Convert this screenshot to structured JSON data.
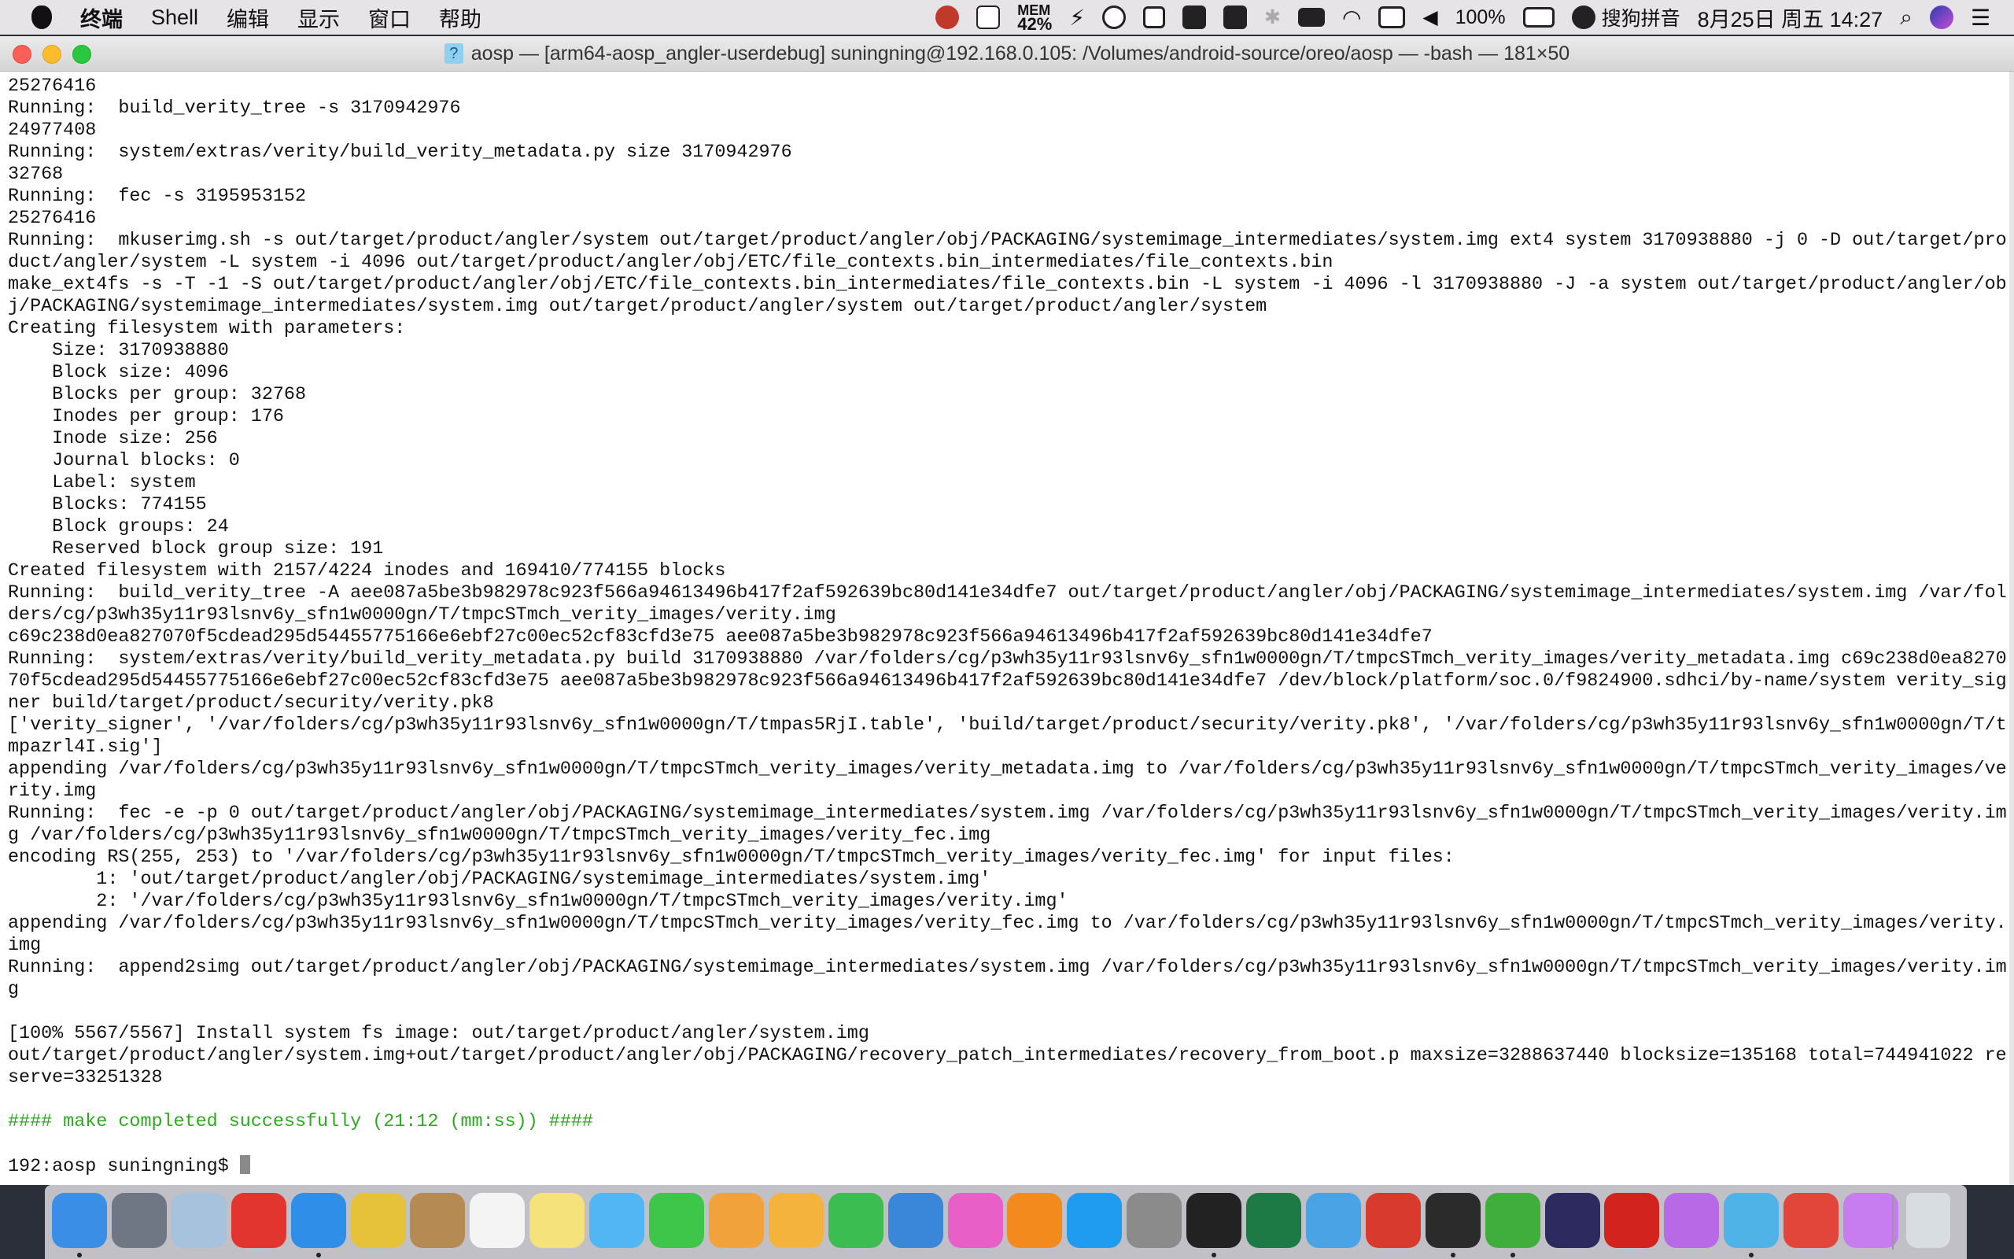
{
  "menubar": {
    "app_menus": [
      "终端",
      "Shell",
      "编辑",
      "显示",
      "窗口",
      "帮助"
    ],
    "mem_label": "MEM",
    "mem_value": "42%",
    "battery": "100%",
    "input_method": "搜狗拼音",
    "datetime": "8月25日 周五 14:27"
  },
  "window": {
    "title": "aosp — [arm64-aosp_angler-userdebug] suningning@192.168.0.105: /Volumes/android-source/oreo/aosp — -bash — 181×50",
    "title_icon": "?"
  },
  "terminal": {
    "success_color": "#2ea821",
    "lines": [
      "25276416",
      "Running:  build_verity_tree -s 3170942976",
      "24977408",
      "Running:  system/extras/verity/build_verity_metadata.py size 3170942976",
      "32768",
      "Running:  fec -s 3195953152",
      "25276416",
      "Running:  mkuserimg.sh -s out/target/product/angler/system out/target/product/angler/obj/PACKAGING/systemimage_intermediates/system.img ext4 system 3170938880 -j 0 -D out/target/pro",
      "duct/angler/system -L system -i 4096 out/target/product/angler/obj/ETC/file_contexts.bin_intermediates/file_contexts.bin",
      "make_ext4fs -s -T -1 -S out/target/product/angler/obj/ETC/file_contexts.bin_intermediates/file_contexts.bin -L system -i 4096 -l 3170938880 -J -a system out/target/product/angler/ob",
      "j/PACKAGING/systemimage_intermediates/system.img out/target/product/angler/system out/target/product/angler/system",
      "Creating filesystem with parameters:",
      "    Size: 3170938880",
      "    Block size: 4096",
      "    Blocks per group: 32768",
      "    Inodes per group: 176",
      "    Inode size: 256",
      "    Journal blocks: 0",
      "    Label: system",
      "    Blocks: 774155",
      "    Block groups: 24",
      "    Reserved block group size: 191",
      "Created filesystem with 2157/4224 inodes and 169410/774155 blocks",
      "Running:  build_verity_tree -A aee087a5be3b982978c923f566a94613496b417f2af592639bc80d141e34dfe7 out/target/product/angler/obj/PACKAGING/systemimage_intermediates/system.img /var/fol",
      "ders/cg/p3wh35y11r93lsnv6y_sfn1w0000gn/T/tmpcSTmch_verity_images/verity.img",
      "c69c238d0ea827070f5cdead295d54455775166e6ebf27c00ec52cf83cfd3e75 aee087a5be3b982978c923f566a94613496b417f2af592639bc80d141e34dfe7",
      "Running:  system/extras/verity/build_verity_metadata.py build 3170938880 /var/folders/cg/p3wh35y11r93lsnv6y_sfn1w0000gn/T/tmpcSTmch_verity_images/verity_metadata.img c69c238d0ea8270",
      "70f5cdead295d54455775166e6ebf27c00ec52cf83cfd3e75 aee087a5be3b982978c923f566a94613496b417f2af592639bc80d141e34dfe7 /dev/block/platform/soc.0/f9824900.sdhci/by-name/system verity_sig",
      "ner build/target/product/security/verity.pk8",
      "['verity_signer', '/var/folders/cg/p3wh35y11r93lsnv6y_sfn1w0000gn/T/tmpas5RjI.table', 'build/target/product/security/verity.pk8', '/var/folders/cg/p3wh35y11r93lsnv6y_sfn1w0000gn/T/t",
      "mpazrl4I.sig']",
      "appending /var/folders/cg/p3wh35y11r93lsnv6y_sfn1w0000gn/T/tmpcSTmch_verity_images/verity_metadata.img to /var/folders/cg/p3wh35y11r93lsnv6y_sfn1w0000gn/T/tmpcSTmch_verity_images/ve",
      "rity.img",
      "Running:  fec -e -p 0 out/target/product/angler/obj/PACKAGING/systemimage_intermediates/system.img /var/folders/cg/p3wh35y11r93lsnv6y_sfn1w0000gn/T/tmpcSTmch_verity_images/verity.im",
      "g /var/folders/cg/p3wh35y11r93lsnv6y_sfn1w0000gn/T/tmpcSTmch_verity_images/verity_fec.img",
      "encoding RS(255, 253) to '/var/folders/cg/p3wh35y11r93lsnv6y_sfn1w0000gn/T/tmpcSTmch_verity_images/verity_fec.img' for input files:",
      "        1: 'out/target/product/angler/obj/PACKAGING/systemimage_intermediates/system.img'",
      "        2: '/var/folders/cg/p3wh35y11r93lsnv6y_sfn1w0000gn/T/tmpcSTmch_verity_images/verity.img'",
      "appending /var/folders/cg/p3wh35y11r93lsnv6y_sfn1w0000gn/T/tmpcSTmch_verity_images/verity_fec.img to /var/folders/cg/p3wh35y11r93lsnv6y_sfn1w0000gn/T/tmpcSTmch_verity_images/verity.",
      "img",
      "Running:  append2simg out/target/product/angler/obj/PACKAGING/systemimage_intermediates/system.img /var/folders/cg/p3wh35y11r93lsnv6y_sfn1w0000gn/T/tmpcSTmch_verity_images/verity.im",
      "g",
      "",
      "[100% 5567/5567] Install system fs image: out/target/product/angler/system.img",
      "out/target/product/angler/system.img+out/target/product/angler/obj/PACKAGING/recovery_patch_intermediates/recovery_from_boot.p maxsize=3288637440 blocksize=135168 total=744941022 re",
      "serve=33251328",
      "",
      "#### make completed successfully (21:12 (mm:ss)) ####",
      "",
      "192:aosp suningning$ "
    ],
    "success_line_index": 47
  },
  "dock": {
    "items": [
      {
        "name": "finder-icon",
        "color": "#3a8ee6",
        "running": true
      },
      {
        "name": "launchpad-icon",
        "color": "#6f7785",
        "running": false
      },
      {
        "name": "preview-icon",
        "color": "#a7c2dc",
        "running": false
      },
      {
        "name": "g-app-icon",
        "color": "#e2352f",
        "running": false
      },
      {
        "name": "safari-icon",
        "color": "#2f8fe8",
        "running": true
      },
      {
        "name": "chrome-icon",
        "color": "#e6c23a",
        "running": false
      },
      {
        "name": "contacts-icon",
        "color": "#b58a53",
        "running": false
      },
      {
        "name": "calendar-icon",
        "color": "#f4f4f4",
        "running": false
      },
      {
        "name": "notes-icon",
        "color": "#f6e27a",
        "running": false
      },
      {
        "name": "messages-icon",
        "color": "#52b6f5",
        "running": false
      },
      {
        "name": "facetime-icon",
        "color": "#3ec64a",
        "running": false
      },
      {
        "name": "photos-icon",
        "color": "#f2a23a",
        "running": false
      },
      {
        "name": "pages-icon",
        "color": "#f3b33c",
        "running": false
      },
      {
        "name": "numbers-icon",
        "color": "#3bbd52",
        "running": false
      },
      {
        "name": "keynote-icon",
        "color": "#3a86d8",
        "running": false
      },
      {
        "name": "itunes-icon",
        "color": "#e95fc8",
        "running": false
      },
      {
        "name": "ibooks-icon",
        "color": "#f28a1e",
        "running": false
      },
      {
        "name": "app-store-icon",
        "color": "#1f9bf0",
        "running": false
      },
      {
        "name": "system-preferences-icon",
        "color": "#8b8b8b",
        "running": false
      },
      {
        "name": "qq-icon",
        "color": "#222222",
        "running": true
      },
      {
        "name": "excel-icon",
        "color": "#1e7a45",
        "running": false
      },
      {
        "name": "xcode-icon",
        "color": "#4aa3e5",
        "running": false
      },
      {
        "name": "parallels-icon",
        "color": "#d93a2e",
        "running": false
      },
      {
        "name": "terminal-icon",
        "color": "#2b2b2b",
        "running": true
      },
      {
        "name": "evernote-icon",
        "color": "#3fae3c",
        "running": true
      },
      {
        "name": "eclipse-icon",
        "color": "#2c2a5e",
        "running": false
      },
      {
        "name": "acrobat-icon",
        "color": "#d2231e",
        "running": false
      },
      {
        "name": "flower-app-icon",
        "color": "#b86ae6",
        "running": false
      },
      {
        "name": "paper-plane-icon",
        "color": "#4fb3e8",
        "running": true
      },
      {
        "name": "bookmark-app-icon",
        "color": "#e2463a",
        "running": false
      },
      {
        "name": "flower-app-2-icon",
        "color": "#c77df0",
        "running": false
      }
    ],
    "trash": {
      "name": "trash-icon",
      "color": "#d8dde2"
    }
  }
}
